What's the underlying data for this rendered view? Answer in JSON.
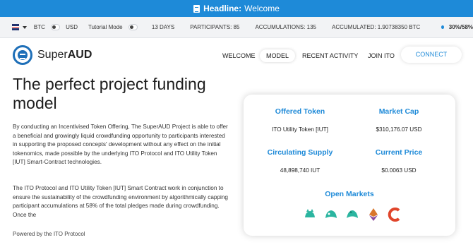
{
  "headline": {
    "label": "Headline:",
    "text": "Welcome"
  },
  "status": {
    "currency_a": "BTC",
    "currency_b": "USD",
    "tutorial_mode": "Tutorial Mode",
    "days": "13 DAYS",
    "participants": "PARTICIPANTS: 85",
    "accumulations": "ACCUMULATIONS: 135",
    "accumulated": "ACCUMULATED: 1.90738350 BTC",
    "progress_text": "30%/58%"
  },
  "nav": {
    "logo_light": "Super",
    "logo_bold": "AUD",
    "items": [
      "WELCOME",
      "MODEL",
      "RECENT ACTIVITY",
      "JOIN ITO"
    ],
    "connect": "CONNECT"
  },
  "hero": {
    "title": "The perfect project funding model",
    "p1": "By conducting an Incentivised Token Offering, The SuperAUD Project is able to offer a beneficial and growingly liquid crowdfunding opportunity to participants interested in supporting the proposed concepts' development without any effect on the initial tokenomics, made possible by the underlying ITO Protocol and ITO Utility Token [IUT] Smart-Contract technologies.",
    "p2": "The ITO Protocol and ITO Utility Token [IUT] Smart Contract work in conjunction to ensure the sustainability of the crowdfunding environment by algorithmically capping participant accumulations at 58% of the total pledges made during crowdfunding. Once the",
    "powered": "Powered by the ITO Protocol"
  },
  "card": {
    "offered_token_label": "Offered Token",
    "offered_token_value": "ITO Utility Token [IUT]",
    "market_cap_label": "Market Cap",
    "market_cap_value": "$310,176.07 USD",
    "supply_label": "Circulating Supply",
    "supply_value": "48,898,740 IUT",
    "price_label": "Current Price",
    "price_value": "$0.0063 USD",
    "markets_label": "Open Markets",
    "market_icons": [
      "pancakeswap-icon",
      "uniswap-icon",
      "sushiswap-icon",
      "ethereum-icon",
      "coingecko-icon"
    ]
  },
  "colors": {
    "accent": "#1e8ad8",
    "brand": "#1e6fb8"
  }
}
